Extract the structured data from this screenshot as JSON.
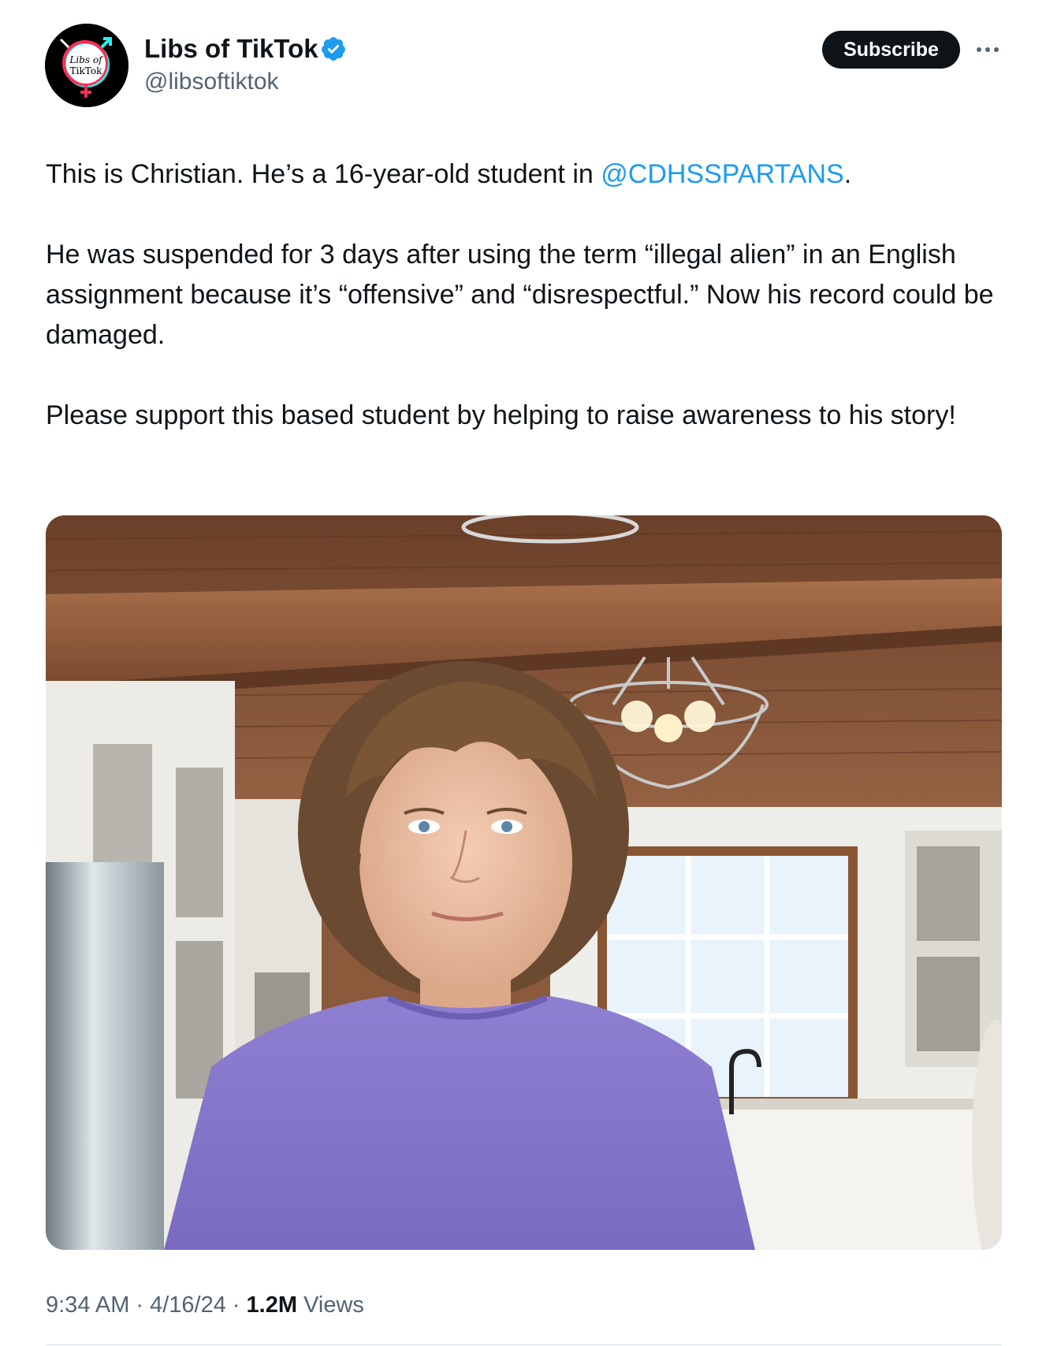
{
  "author": {
    "name": "Libs of TikTok",
    "handle": "@libsoftiktok",
    "avatar_text_line1": "Libs of",
    "avatar_text_line2": "TikTok",
    "verified_icon": "verified-badge-icon"
  },
  "actions": {
    "subscribe_label": "Subscribe",
    "more_icon": "more-icon"
  },
  "tweet": {
    "p1_before": "This is Christian. He’s a 16-year-old student in ",
    "p1_mention": "@CDHSSPARTANS",
    "p1_after": ".",
    "p2": "He was suspended for 3 days after using the term “illegal alien” in an English assignment because it’s “offensive” and “disrespectful.” Now his record could be damaged.",
    "p3": "Please support this based student by helping to raise awareness to his story!"
  },
  "media": {
    "type": "photo"
  },
  "meta": {
    "time": "9:34 AM",
    "separator": "·",
    "date": "4/16/24",
    "views_count": "1.2M",
    "views_label": "Views"
  },
  "colors": {
    "link": "#1d9bf0",
    "secondary_text": "#536471",
    "primary_text": "#0f1419",
    "verified": "#1d9bf0"
  }
}
